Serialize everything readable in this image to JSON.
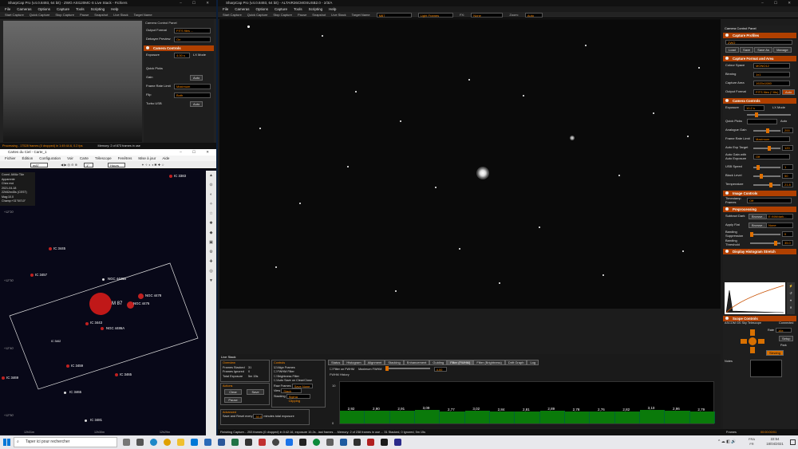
{
  "colors": {
    "accent": "#ff8c00",
    "header": "#b04000",
    "green": "#0a7a0a",
    "desktop": "#0a1e3a"
  },
  "left_sharpcap": {
    "title": "SharpCap Pro (v4.0.8493, 64 bit) - ZWO ASI120MC-S Live Stack - Fichiers",
    "menu": [
      "File",
      "Cameras",
      "Options",
      "Capture",
      "Tools",
      "Scripting",
      "Help"
    ],
    "toolbar": [
      "Start Capture",
      "Quick Capture",
      "Stop Capture",
      "Pause",
      "Snapshot",
      "Live Stack",
      "Target Name"
    ],
    "panel_title": "Camera Control Panel",
    "rows": [
      {
        "label": "Output Format",
        "value": "FITS files ..."
      },
      {
        "label": "Debayer Preview",
        "value": "On"
      }
    ],
    "camera_controls": "Camera Controls",
    "exposure_label": "Exposure",
    "exposure": "4.00 s",
    "lx_mode": "LX Mode",
    "quick_picks": "Quick Picks",
    "gain": "Gain",
    "frame_rate_limit": "Frame Rate Limit",
    "frame_rate_value": "Maximum",
    "flip": "Flip",
    "flip_value": "Both",
    "turbo": "Turbo USB",
    "auto": "Auto",
    "status": "Processing - 17528 frames (0 dropped) in 1:49:44.6, 0.2 fps",
    "memory": "Memory: 2 of 873 frames in use"
  },
  "cdc": {
    "title": "Cartes du Ciel - Carte_1",
    "menu": [
      "Fichier",
      "Édition",
      "Configuration",
      "Voir",
      "Carte",
      "Télescope",
      "Fenêtres",
      "Mise à jour",
      "Aide"
    ],
    "search": "m87",
    "zoom": "1°",
    "units": "Hours",
    "info": [
      "Coord. Alt/Az TAn",
      "Apparente",
      "Chez moi",
      "2021-04-18",
      "22h52m45s (CEST)",
      "Mag:10.0",
      "Champ:+31°00'10\""
    ],
    "objects": [
      {
        "name": "IC 3383"
      },
      {
        "name": "IC 3445"
      },
      {
        "name": "IC 3457"
      },
      {
        "name": "NGC 4486B"
      },
      {
        "name": "NGC 4478"
      },
      {
        "name": "M 87"
      },
      {
        "name": "NGC 4476"
      },
      {
        "name": "IC 3443"
      },
      {
        "name": "NGC 4486A"
      },
      {
        "name": "IC 3462"
      },
      {
        "name": "IC 3459"
      },
      {
        "name": "IC 3465"
      },
      {
        "name": "IC 3465"
      },
      {
        "name": "IC 3469"
      },
      {
        "name": "IC 3481"
      }
    ],
    "dec_labels": [
      "+12°20'",
      "+12°30'",
      "+12°40'",
      "+12°50'",
      "+12°00'"
    ],
    "ra_labels": [
      "12h31m",
      "12h30m",
      "12h29m"
    ]
  },
  "main": {
    "title": "SharpCap Pro (v4.0.8493, 64 bit) - ALTAIR26CMOSUSB2.0 - 2/3/A",
    "menu": [
      "File",
      "Cameras",
      "Options",
      "Capture",
      "Tools",
      "Scripting",
      "Help"
    ],
    "toolbar": [
      "Start Capture",
      "Quick Capture",
      "Stop Capture",
      "Pause",
      "Snapshot",
      "Live Stack",
      "Target Name"
    ],
    "target": "M87",
    "frames": "Light Frames",
    "fx_label": "FX:",
    "fx_value": "None",
    "zoom_label": "Zoom:",
    "zoom_value": "Auto",
    "status": "Finishing Capture... 253 frames (0 dropped) in 0:42:16, exposure 10.2s - last frames ... Memory: 2 of 238 frames in use ... 31 Stacked, 0 Ignored, 5m 15s"
  },
  "control_panel": {
    "title": "Camera Control Panel",
    "sections": {
      "profiles": "Capture Profiles",
      "format": "Capture Format and Area",
      "camera": "Camera Controls",
      "image": "Image Controls",
      "pre": "Preprocessing",
      "hist": "Display Histogram Stretch",
      "scope": "Scope Controls"
    },
    "profile": "ZWO",
    "profile_buttons": [
      "Load",
      "Save",
      "Save As",
      "Manage"
    ],
    "format_rows": [
      {
        "label": "Colour Space",
        "value": "MONO12"
      },
      {
        "label": "Binning",
        "value": "1x1"
      },
      {
        "label": "Capture Area",
        "value": "1920x1080"
      },
      {
        "label": "Output Format",
        "value": "FITS files (*.fits)"
      }
    ],
    "camera_rows": [
      {
        "label": "Exposure",
        "value": "10.2 s"
      },
      {
        "label": "Quick Picks",
        "value": ""
      },
      {
        "label": "Analogue Gain",
        "value": "200"
      },
      {
        "label": "Frame Rate Limit",
        "value": "Maximum"
      },
      {
        "label": "Auto Exp Target",
        "value": "120"
      },
      {
        "label": "Auto Gain with Auto Exposure",
        "value": "Off"
      },
      {
        "label": "USB Speed",
        "value": "1"
      },
      {
        "label": "Black Level",
        "value": "50"
      },
      {
        "label": "Temperature",
        "value": "21.8"
      }
    ],
    "lx": "LX Mode",
    "auto": "Auto",
    "timestamp": "Timestamp Frames",
    "timestamp_value": "Off",
    "subtract_dark": "Subtract Dark",
    "apply_flat": "Apply Flat",
    "browse": "Browse...",
    "dark_value": "E:\\NWdark...",
    "flat_value": "None",
    "banding": "Banding Suppression",
    "banding_value": "0",
    "banding_thr": "Banding Threshold",
    "banding_thr_value": "35.0",
    "scope_name": "ASCOM GS Sky Telescope",
    "connected": "Connected",
    "rate": "Rate",
    "rate_value": "16x",
    "setup": "Setup",
    "park": "Park",
    "slewing": "Slewing",
    "notes": "Notes",
    "frames": "Frames",
    "frames_value": "00:00:00/01"
  },
  "livestack": {
    "title": "Live Stack",
    "overview": "Overview",
    "frames_stacked": "Frames Stacked",
    "frames_stacked_value": "31",
    "frames_ignored": "Frames Ignored",
    "frames_ignored_value": "0",
    "total_exposure": "Total Exposure",
    "total_exposure_value": "5m 15s",
    "actions": "Actions",
    "clear": "Clear",
    "save": "Save",
    "pause": "Pause",
    "advanced": "Advanced",
    "save_reset": "Save and Reset every",
    "minutes": "30.0",
    "minutes_label": "minutes total exposure",
    "controls": "Controls",
    "checks": [
      "Align Frames",
      "FWHM Filter",
      "Brightness Filter",
      "Auto Save on Clear/Close"
    ],
    "raw_frames": "Raw Frames",
    "raw_value": "Save None",
    "view": "View",
    "view_value": "Stack",
    "stacking": "Stacking",
    "stacking_value": "Sigma Clipping",
    "tabs": [
      "Status",
      "Histogram",
      "Alignment",
      "Stacking",
      "Enhancement",
      "Guiding",
      "Filter (FWHM)",
      "Filter (Brightness)",
      "Drift Graph",
      "Log"
    ],
    "filter_label": "Filter on FWHM",
    "max_fwhm": "Maximum FWHM",
    "max_value": "4.00",
    "history": "FWHM History",
    "y_top": "10",
    "y_bottom": "0"
  },
  "chart_data": {
    "type": "bar",
    "title": "FWHM History",
    "values": [
      2.92,
      2.9,
      2.91,
      3.09,
      2.77,
      3.02,
      2.84,
      2.81,
      2.89,
      2.78,
      2.76,
      2.82,
      3.1,
      2.96,
      2.79
    ],
    "labels": [
      "2,92",
      "2,90",
      "2,91",
      "3,09",
      "2,77",
      "3,02",
      "2,84",
      "2,81",
      "2,89",
      "2,78",
      "2,76",
      "2,82",
      "3,10",
      "2,96",
      "2,79"
    ],
    "ylim": [
      0,
      10
    ]
  },
  "taskbar": {
    "search": "Taper ici pour rechercher",
    "lang": "FRA",
    "lang2": "FR",
    "time": "22:54",
    "date": "18/04/2021"
  }
}
